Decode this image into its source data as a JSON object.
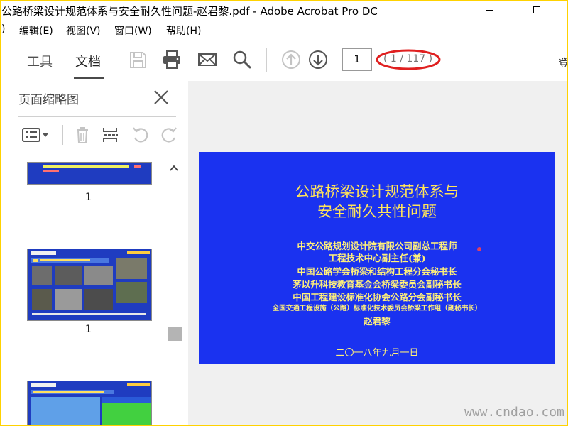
{
  "window": {
    "title": "公路桥梁设计规范体系与安全耐久性问题-赵君黎.pdf - Adobe Acrobat Pro DC"
  },
  "menu": {
    "items": [
      {
        "label": ")"
      },
      {
        "label": "编辑(E)"
      },
      {
        "label": "视图(V)"
      },
      {
        "label": "窗口(W)"
      },
      {
        "label": "帮助(H)"
      }
    ]
  },
  "toolbar": {
    "tab_tools": "工具",
    "tab_document": "文档",
    "page_current": "1",
    "page_count": "( 1 / 117 )",
    "login_partial": "登",
    "icons": [
      "save-icon",
      "print-icon",
      "email-icon",
      "search-icon",
      "prev-page-icon",
      "next-page-icon"
    ]
  },
  "sidepanel": {
    "title": "页面缩略图",
    "thumbnails": [
      {
        "label": "1"
      },
      {
        "label": "1"
      }
    ]
  },
  "slide": {
    "title_line1": "公路桥梁设计规范体系与",
    "title_line2": "安全耐久共性问题",
    "lines": [
      "中交公路规划设计院有限公司副总工程师",
      "工程技术中心副主任(兼)",
      "中国公路学会桥梁和结构工程分会秘书长",
      "茅以升科技教育基金会桥梁委员会副秘书长",
      "中国工程建设标准化协会公路分会副秘书长",
      "全国交通工程设施（公路）标准化技术委员会桥梁工作组（副秘书长）",
      "赵君黎"
    ],
    "date": "二〇一八年九月一日"
  },
  "watermark": "www.cndao.com",
  "colors": {
    "frame_border": "#ffd200",
    "slide_bg": "#1a32f0",
    "slide_title": "#ffe45a",
    "annotation_ellipse": "#e02020"
  }
}
